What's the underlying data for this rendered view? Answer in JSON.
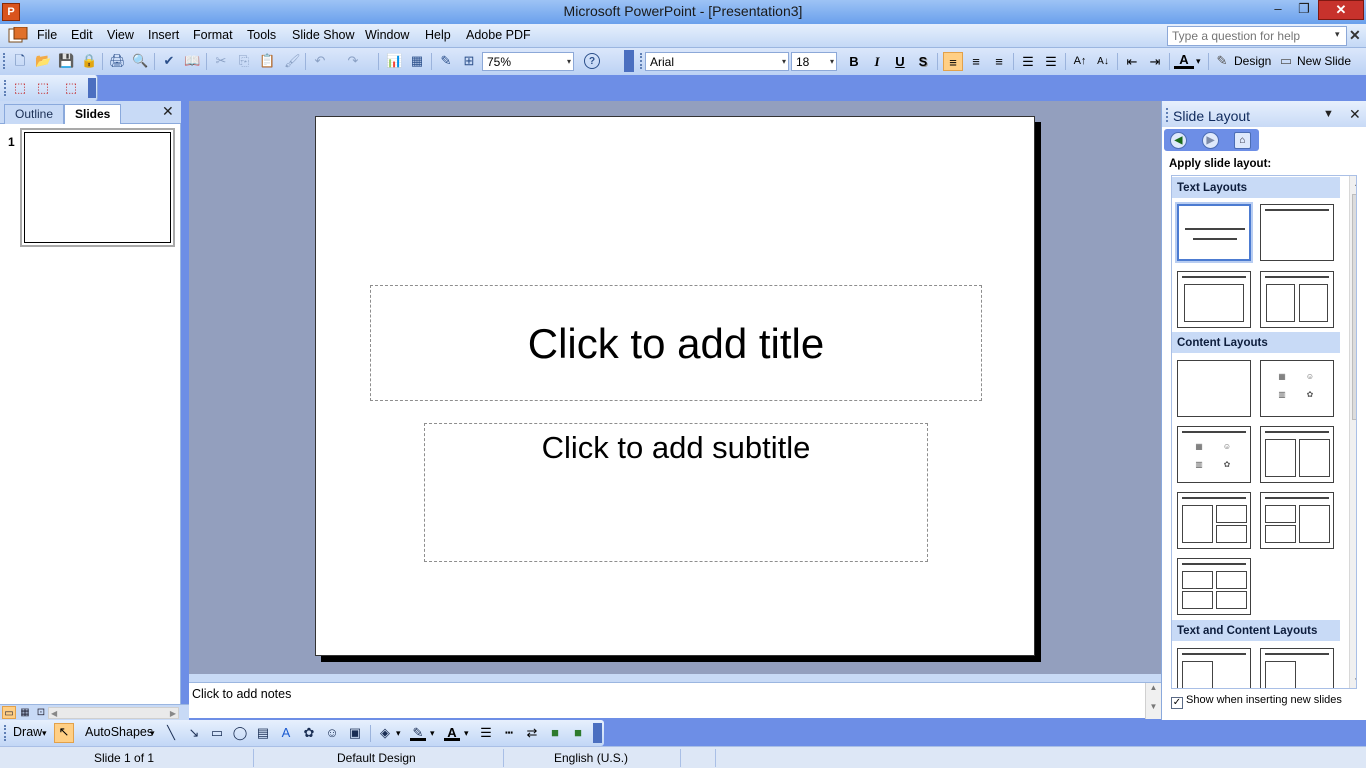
{
  "window": {
    "title": "Microsoft PowerPoint - [Presentation3]",
    "app_icon_letter": "P",
    "minimize_glyph": "–",
    "maximize_glyph": "❐",
    "close_glyph": "✕"
  },
  "menu": {
    "items": [
      "File",
      "Edit",
      "View",
      "Insert",
      "Format",
      "Tools",
      "Slide Show",
      "Window",
      "Help",
      "Adobe PDF"
    ],
    "ask_placeholder": "Type a question for help",
    "ask_dropdown_glyph": "▾",
    "doc_close_glyph": "✕"
  },
  "toolbar": {
    "zoom": "75%",
    "font_name": "Arial",
    "font_size": "18",
    "bold": "B",
    "italic": "I",
    "underline": "U",
    "shadow": "S",
    "design_label": "Design",
    "new_slide_label": "New Slide",
    "combo_arrow": "▾",
    "icons": {
      "new": "🗋",
      "open": "📂",
      "save": "💾",
      "permission": "🔒",
      "print": "🖨",
      "preview": "🔍",
      "spelling": "✔",
      "research": "📖",
      "cut": "✂",
      "copy": "⎘",
      "paste": "📋",
      "format_painter": "🖌",
      "undo": "↶",
      "redo": "↷",
      "chart": "📊",
      "table": "▦",
      "tables_borders": "✎",
      "grid": "⊞",
      "help": "?",
      "numbering": "☰",
      "bullets": "☰",
      "increase_font": "A↑",
      "decrease_font": "A↓",
      "decrease_indent": "⇤",
      "increase_indent": "⇥",
      "font_color": "A",
      "align_left": "≡",
      "center": "≡",
      "align_right": "≡"
    },
    "pdf_icons": [
      "⬚",
      "⬚",
      "⬚"
    ]
  },
  "left_pane": {
    "tab_outline": "Outline",
    "tab_slides": "Slides",
    "close_glyph": "✕",
    "slide_number": "1"
  },
  "slide": {
    "title_placeholder": "Click to add title",
    "subtitle_placeholder": "Click to add subtitle"
  },
  "notes": {
    "placeholder": "Click to add notes",
    "scroll_up": "▲",
    "scroll_down": "▼"
  },
  "view_buttons": {
    "normal": "▭",
    "sorter": "▦",
    "slideshow": "⊡",
    "scroll_left": "◀",
    "scroll_right": "▶"
  },
  "task_pane": {
    "title": "Slide Layout",
    "dropdown_glyph": "▼",
    "close_glyph": "✕",
    "nav_back": "◀",
    "nav_forward": "▶",
    "nav_home": "⌂",
    "apply_label": "Apply slide layout:",
    "sections": {
      "text_layouts": "Text Layouts",
      "content_layouts": "Content Layouts",
      "text_and_content_layouts": "Text and Content Layouts"
    },
    "show_when_inserting": "Show when inserting new slides",
    "show_checked": "✓",
    "scroll_up": "▲",
    "scroll_down": "▼"
  },
  "draw_toolbar": {
    "draw_label": "Draw",
    "autoshapes_label": "AutoShapes",
    "dropdown_glyph": "▾"
  },
  "status": {
    "slide_info": "Slide 1 of 1",
    "design": "Default Design",
    "language": "English (U.S.)"
  }
}
